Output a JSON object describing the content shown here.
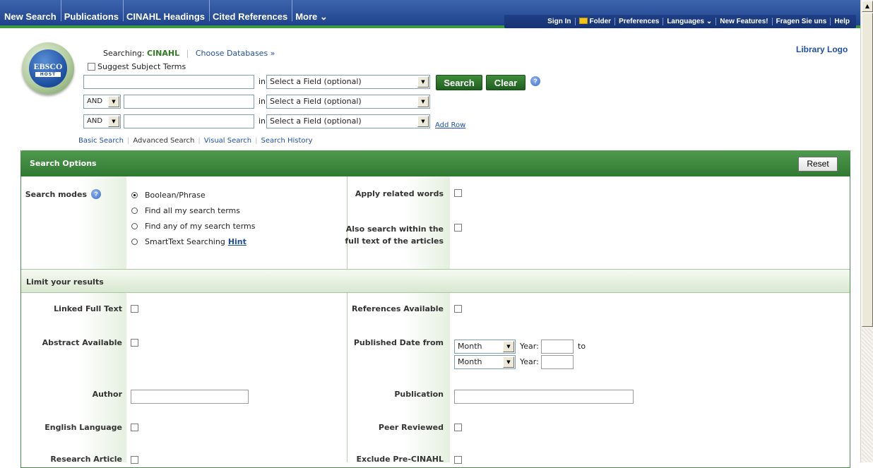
{
  "topnav": {
    "items": [
      "New Search",
      "Publications",
      "CINAHL Headings",
      "Cited References",
      "More ⌄"
    ]
  },
  "utility": {
    "items": [
      "Sign In",
      "Folder",
      "Preferences",
      "Languages ⌄",
      "New Features!",
      "Fragen Sie uns",
      "Help"
    ]
  },
  "search": {
    "searching_label": "Searching:",
    "database": "CINAHL",
    "choose_db": "Choose Databases »",
    "suggest_label": "Suggest Subject Terms",
    "in_label": "in",
    "field_placeholder": "Select a Field (optional)",
    "bool_op": "AND",
    "search_btn": "Search",
    "clear_btn": "Clear",
    "add_row": "Add Row",
    "links": [
      "Basic Search",
      "Advanced Search",
      "Visual Search",
      "Search History"
    ]
  },
  "logo": {
    "text": "EBSCO",
    "sub": "HOST"
  },
  "library_logo": "Library Logo",
  "options": {
    "header": "Search Options",
    "reset": "Reset",
    "search_modes_label": "Search modes",
    "modes": [
      "Boolean/Phrase",
      "Find all my search terms",
      "Find any of my search terms",
      "SmartText Searching"
    ],
    "hint": "Hint",
    "apply_related": "Apply related words",
    "also_search_1": "Also search within the",
    "also_search_2": "full text of the articles"
  },
  "limits": {
    "header": "Limit your results",
    "linked_full_text": "Linked Full Text",
    "references_available": "References Available",
    "abstract_available": "Abstract Available",
    "published_date_from": "Published Date from",
    "month": "Month",
    "year": "Year:",
    "to": "to",
    "author": "Author",
    "publication": "Publication",
    "english_language": "English Language",
    "peer_reviewed": "Peer Reviewed",
    "research_article": "Research Article",
    "exclude_pre_cinahl": "Exclude Pre-CINAHL"
  },
  "colors": {
    "topbar": "#2a4f9a",
    "green_accent": "#2f7a30",
    "link_blue": "#1f4fa6"
  }
}
